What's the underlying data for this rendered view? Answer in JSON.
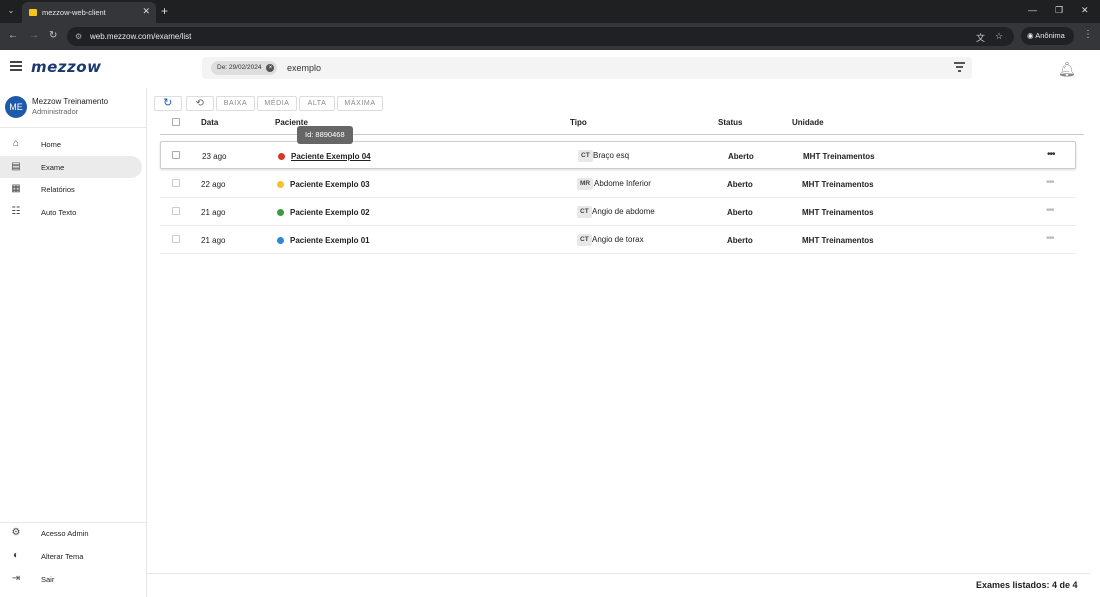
{
  "browser": {
    "tab_title": "mezzow-web-client",
    "url": "web.mezzow.com/exame/list",
    "profile_label": "Anônima"
  },
  "header": {
    "logo": "mezzow",
    "filter_chip": "De: 29/02/2024",
    "search_value": "exemplo"
  },
  "user": {
    "initials": "ME",
    "name": "Mezzow Treinamento",
    "role": "Administrador"
  },
  "sidebar": {
    "items": [
      {
        "label": "Home",
        "icon": "home-icon"
      },
      {
        "label": "Exame",
        "icon": "exam-list-icon",
        "active": true
      },
      {
        "label": "Relatórios",
        "icon": "report-icon"
      },
      {
        "label": "Auto Texto",
        "icon": "auto-text-icon"
      }
    ],
    "bottom_items": [
      {
        "label": "Acesso Admin",
        "icon": "gear-icon"
      },
      {
        "label": "Alterar Tema",
        "icon": "theme-icon"
      },
      {
        "label": "Sair",
        "icon": "logout-icon"
      }
    ]
  },
  "toolbar": {
    "priority_buttons": [
      "BAIXA",
      "MÉDIA",
      "ALTA",
      "MÁXIMA"
    ]
  },
  "table": {
    "columns": [
      "Data",
      "Paciente",
      "Tipo",
      "Status",
      "Unidade"
    ],
    "rows": [
      {
        "date": "23 ago",
        "patient": "Paciente Exemplo 04",
        "dot_color": "#d9362b",
        "modality": "CT",
        "type": "Braço esq",
        "status": "Aberto",
        "unit": "MHT Treinamentos"
      },
      {
        "date": "22 ago",
        "patient": "Paciente Exemplo 03",
        "dot_color": "#f2c12e",
        "modality": "MR",
        "type": "Abdome Inferior",
        "status": "Aberto",
        "unit": "MHT Treinamentos"
      },
      {
        "date": "21 ago",
        "patient": "Paciente Exemplo 02",
        "dot_color": "#3a9c3e",
        "modality": "CT",
        "type": "Angio de abdome",
        "status": "Aberto",
        "unit": "MHT Treinamentos"
      },
      {
        "date": "21 ago",
        "patient": "Paciente Exemplo 01",
        "dot_color": "#2f86d6",
        "modality": "CT",
        "type": "Angio de torax",
        "status": "Aberto",
        "unit": "MHT Treinamentos"
      }
    ]
  },
  "tooltip": "Id: 8890468",
  "footer": {
    "summary": "Exames listados: 4 de 4"
  }
}
